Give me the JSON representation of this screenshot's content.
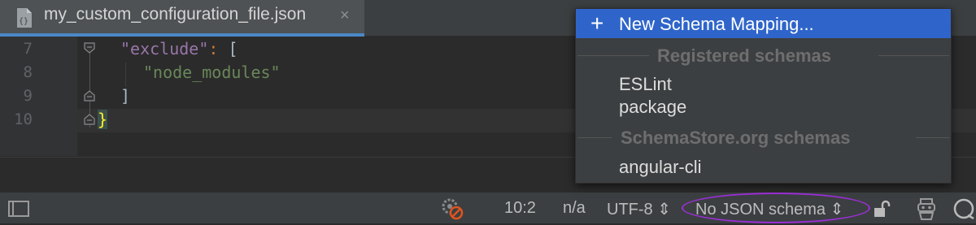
{
  "tab": {
    "filename": "my_custom_configuration_file.json",
    "close_glyph": "×"
  },
  "editor": {
    "line_numbers": [
      "7",
      "8",
      "9",
      "10"
    ],
    "lines": {
      "l7_key": "\"exclude\"",
      "l7_colon": ": ",
      "l7_bracket": "[",
      "l8_value": "\"node_modules\"",
      "l9_bracket": "]",
      "l10_brace": "}"
    }
  },
  "popup": {
    "selected_item": "New Schema Mapping...",
    "plus_glyph": "+",
    "registered_title": "Registered schemas",
    "registered_items": [
      "ESLint",
      "package"
    ],
    "schemastore_title": "SchemaStore.org schemas",
    "schemastore_items": [
      "angular-cli"
    ]
  },
  "statusbar": {
    "position": "10:2",
    "lf": "n/a",
    "encoding": "UTF-8 ⇕",
    "schema": "No JSON schema ⇕"
  },
  "colors": {
    "key": "#9876aa",
    "string": "#6a8759",
    "bracket": "#a9b7c6",
    "brace_highlight": "#ffef28",
    "accent": "#2f65ca",
    "annotation": "#9b2fd8"
  }
}
